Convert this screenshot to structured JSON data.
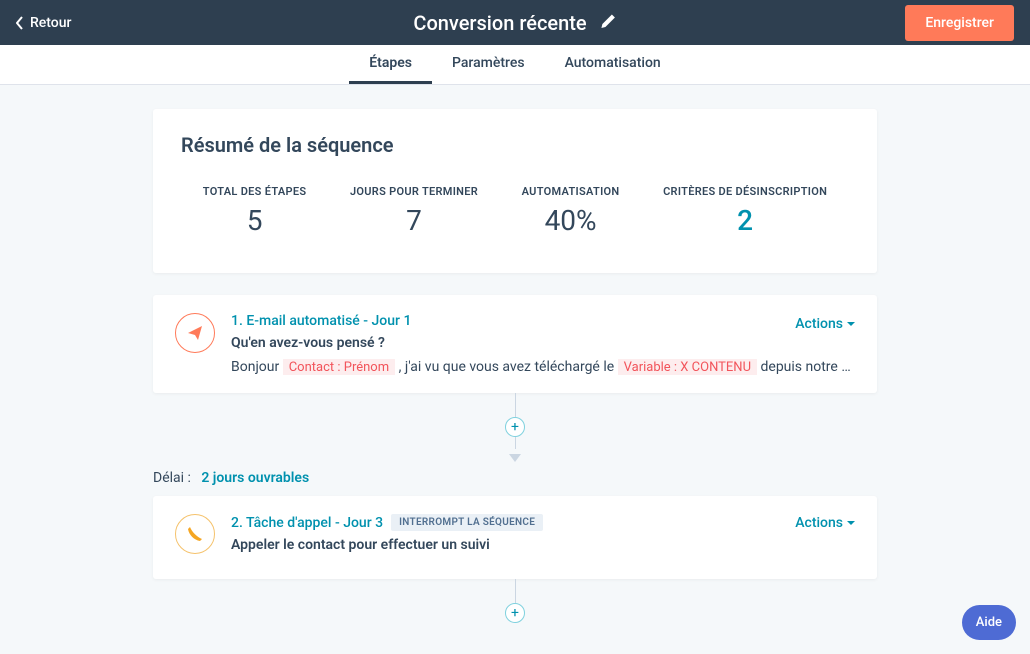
{
  "header": {
    "back_label": "Retour",
    "title": "Conversion récente",
    "save_label": "Enregistrer"
  },
  "tabs": {
    "steps": "Étapes",
    "settings": "Paramètres",
    "automation": "Automatisation"
  },
  "summary": {
    "title": "Résumé de la séquence",
    "stats": {
      "total_steps_label": "TOTAL DES ÉTAPES",
      "total_steps_value": "5",
      "days_label": "JOURS POUR TERMINER",
      "days_value": "7",
      "automation_label": "AUTOMATISATION",
      "automation_value": "40%",
      "unsub_label": "CRITÈRES DE DÉSINSCRIPTION",
      "unsub_value": "2"
    }
  },
  "step1": {
    "type_label": "1. E-mail automatisé - Jour 1",
    "actions_label": "Actions",
    "subject": "Qu'en avez-vous pensé ?",
    "preview_prefix": "Bonjour ",
    "token_contact": "Contact : Prénom",
    "preview_mid": ", j'ai vu que vous avez téléchargé le ",
    "token_content": "Variable : X CONTENU",
    "preview_suffix": " depuis notre site web et je sou…"
  },
  "delay": {
    "label": "Délai :",
    "value": "2 jours ouvrables"
  },
  "step2": {
    "type_label": "2. Tâche d'appel - Jour 3",
    "badge": "INTERROMPT LA SÉQUENCE",
    "actions_label": "Actions",
    "subject": "Appeler le contact pour effectuer un suivi"
  },
  "help": {
    "label": "Aide"
  }
}
